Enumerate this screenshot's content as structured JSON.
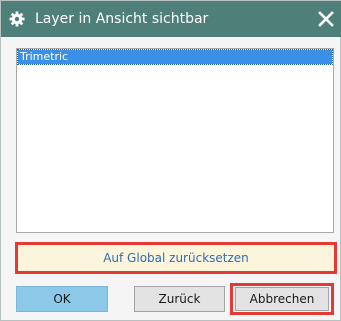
{
  "window": {
    "title": "Layer in Ansicht sichtbar",
    "title_icon": "gear-icon",
    "close_icon": "close-icon",
    "titlebar_color": "#4e7f79"
  },
  "list": {
    "items": [
      {
        "label": "Trimetric",
        "selected": true
      }
    ],
    "selection_color": "#3a90e6"
  },
  "actions": {
    "reset_label": "Auf Global zurücksetzen",
    "ok_label": "OK",
    "back_label": "Zurück",
    "cancel_label": "Abbrechen"
  },
  "highlight_color": "#e53935"
}
